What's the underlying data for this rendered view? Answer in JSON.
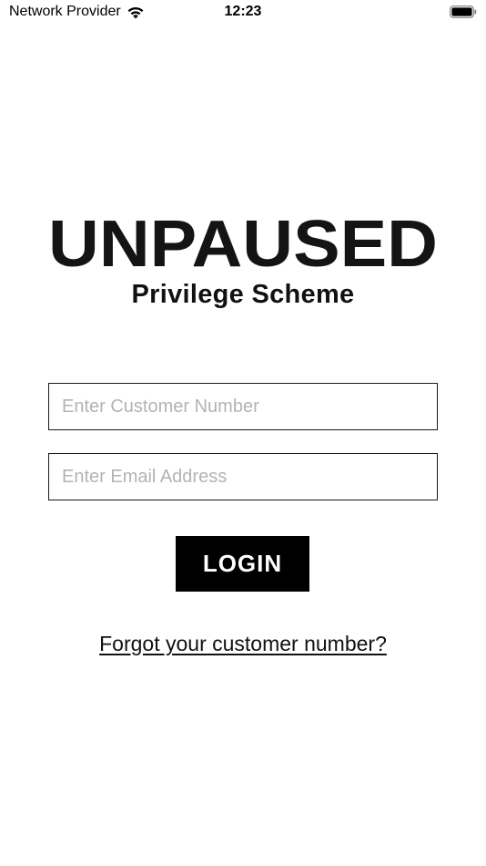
{
  "status_bar": {
    "carrier": "Network Provider",
    "time": "12:23",
    "wifi_icon": "wifi-icon",
    "battery_icon": "battery-full-icon"
  },
  "brand": {
    "logo_text": "UNPAUSED",
    "subtitle": "Privilege Scheme"
  },
  "form": {
    "customer_number": {
      "value": "",
      "placeholder": "Enter Customer Number"
    },
    "email": {
      "value": "",
      "placeholder": "Enter Email Address"
    },
    "login_label": "LOGIN",
    "forgot_label": "Forgot your customer number?"
  },
  "colors": {
    "background": "#ffffff",
    "primary": "#000000",
    "placeholder": "#b3b3b3"
  }
}
